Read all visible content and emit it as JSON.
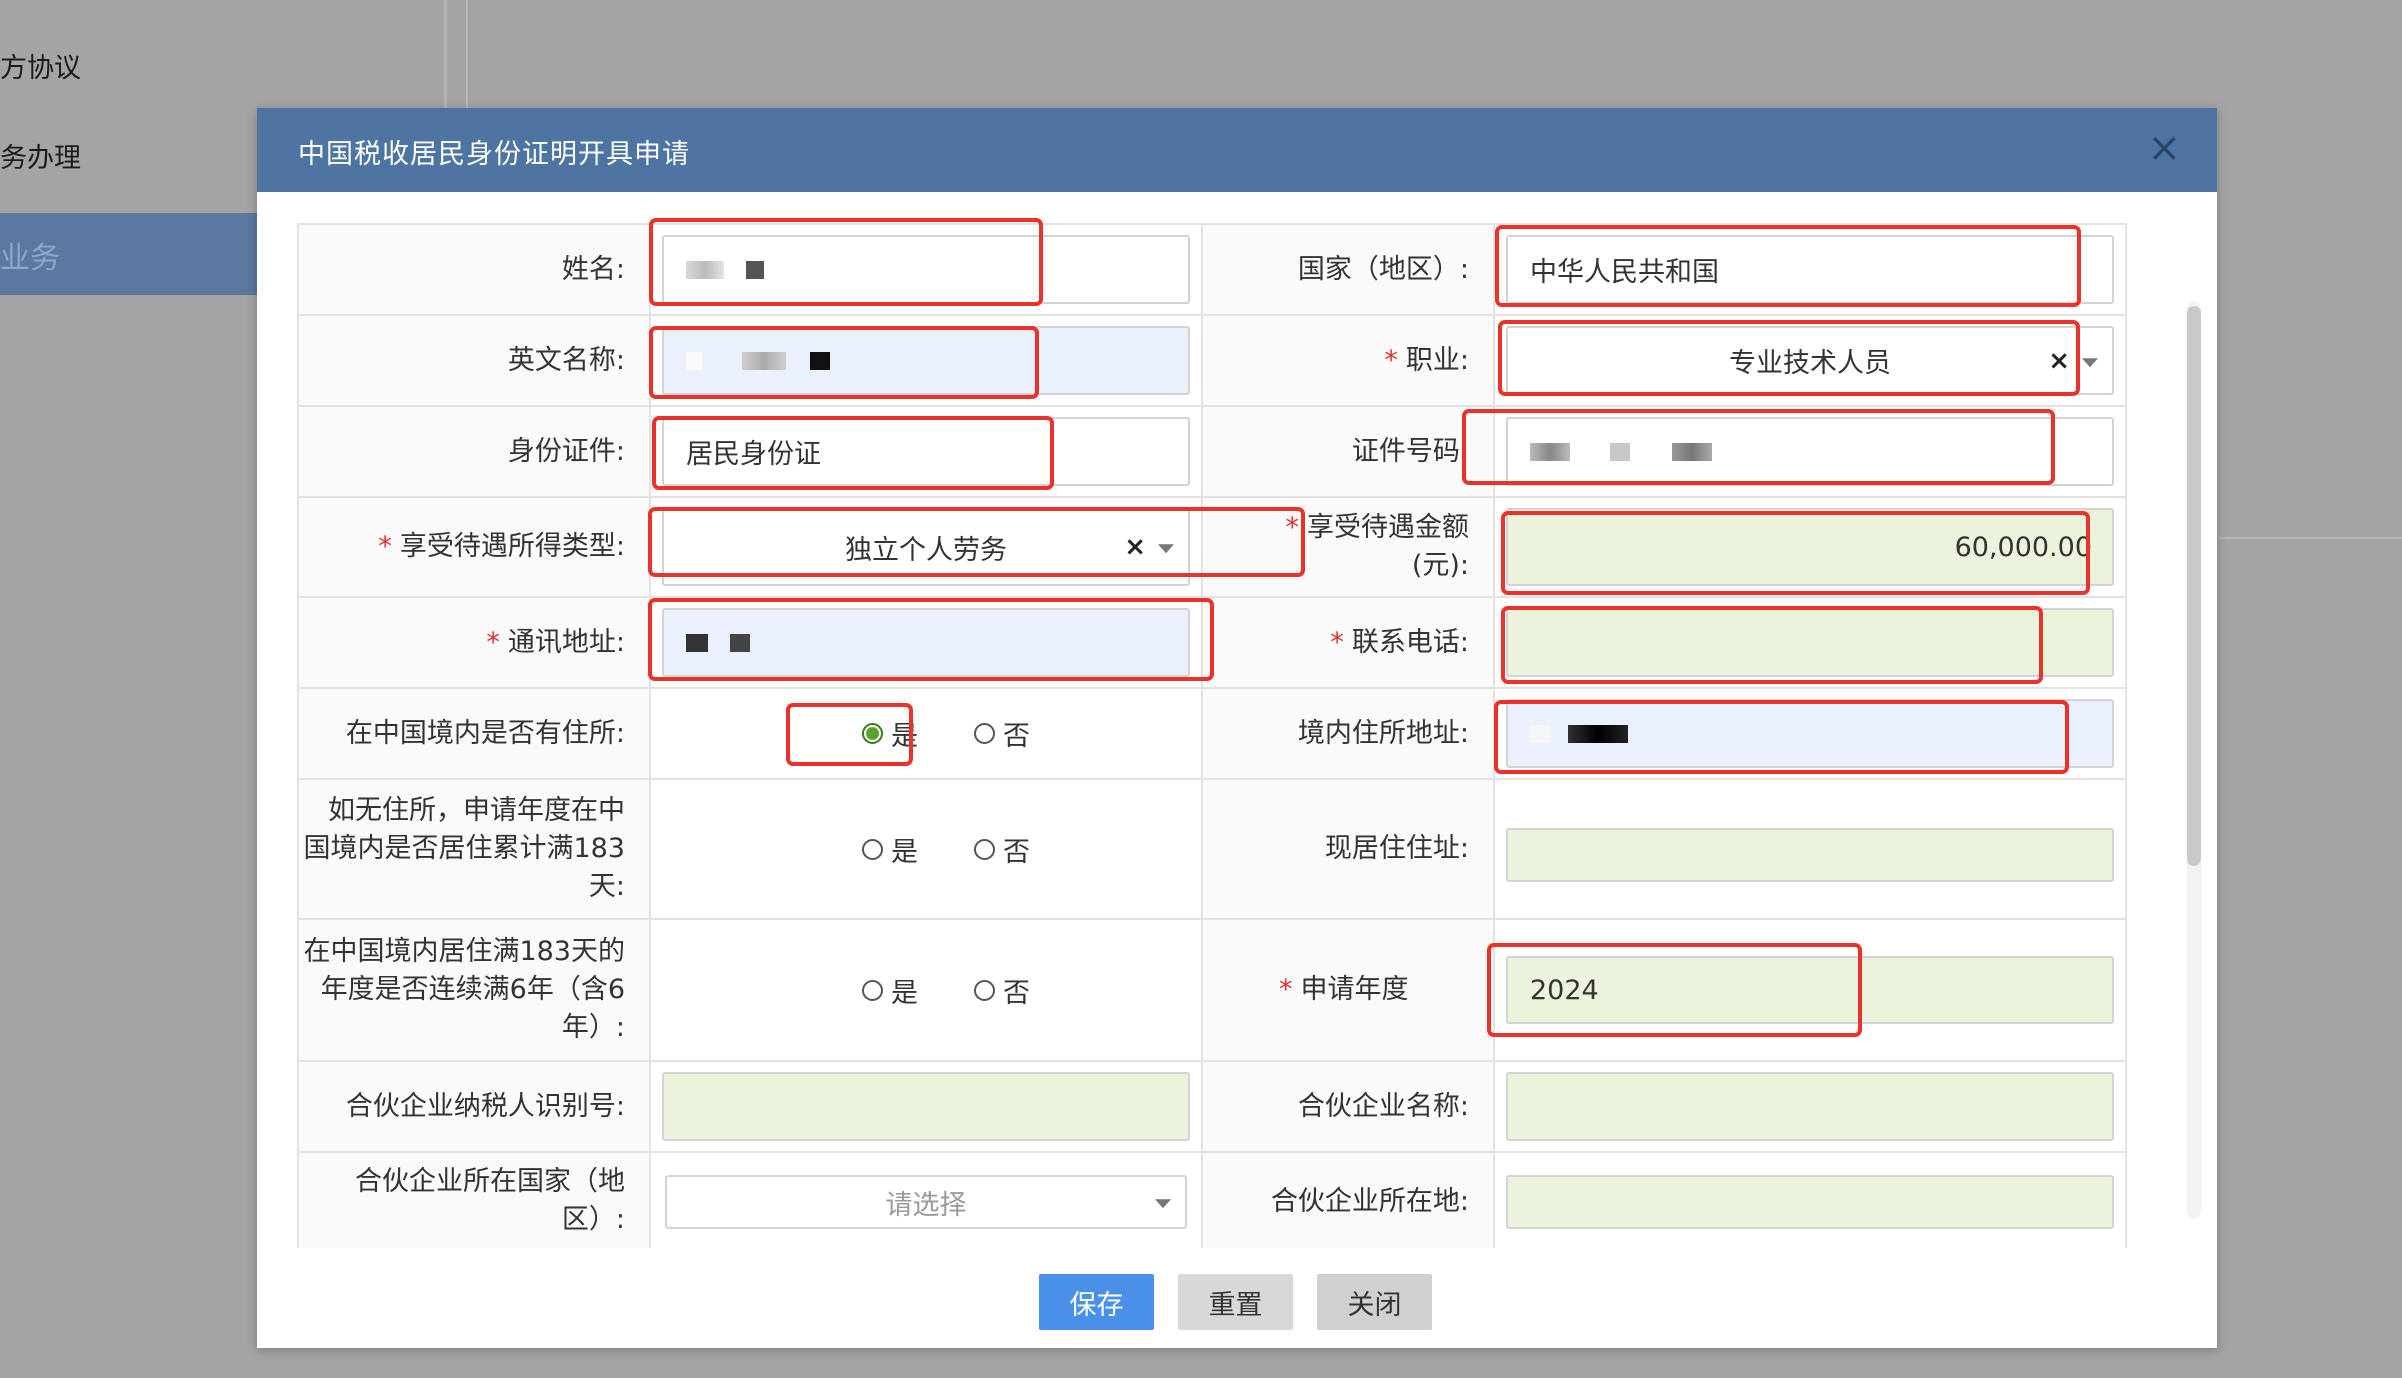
{
  "background_nav": {
    "items": [
      "方协议",
      "务办理"
    ],
    "active": "业务"
  },
  "modal": {
    "title": "中国税收居民身份证明开具申请",
    "close_icon": "×"
  },
  "form": {
    "name_label": "姓名:",
    "country_label": "国家（地区）:",
    "country_value": "中华人民共和国",
    "english_name_label": "英文名称:",
    "occupation_label": "职业:",
    "occupation_value": "专业技术人员",
    "id_type_label": "身份证件:",
    "id_type_value": "居民身份证",
    "id_number_label": "证件号码:",
    "income_type_label": "享受待遇所得类型:",
    "income_type_value": "独立个人劳务",
    "amount_label_1": "享受待遇金额",
    "amount_label_2": "(元):",
    "amount_value": "60,000.00",
    "address_label": "通讯地址:",
    "phone_label": "联系电话:",
    "has_residence_label": "在中国境内是否有住所:",
    "yes": "是",
    "no": "否",
    "domestic_address_label": "境内住所地址:",
    "no_residence_label_1": "如无住所，申请年度在中",
    "no_residence_label_2": "国境内是否居住累计满183",
    "no_residence_label_3": "天:",
    "current_address_label": "现居住住址:",
    "six_years_label_1": "在中国境内居住满183天的",
    "six_years_label_2": "年度是否连续满6年（含6",
    "six_years_label_3": "年）:",
    "apply_year_label": "申请年度",
    "apply_year_value": "2024",
    "partner_tin_label": "合伙企业纳税人识别号:",
    "partner_name_label": "合伙企业名称:",
    "partner_country_label_1": "合伙企业所在国家（地",
    "partner_country_label_2": "区）:",
    "partner_country_placeholder": "请选择",
    "partner_location_label": "合伙企业所在地:"
  },
  "buttons": {
    "save": "保存",
    "reset": "重置",
    "close": "关闭"
  },
  "colors": {
    "header": "#4e74a2",
    "highlight": "#e8322b",
    "save_button": "#4b90e8"
  }
}
